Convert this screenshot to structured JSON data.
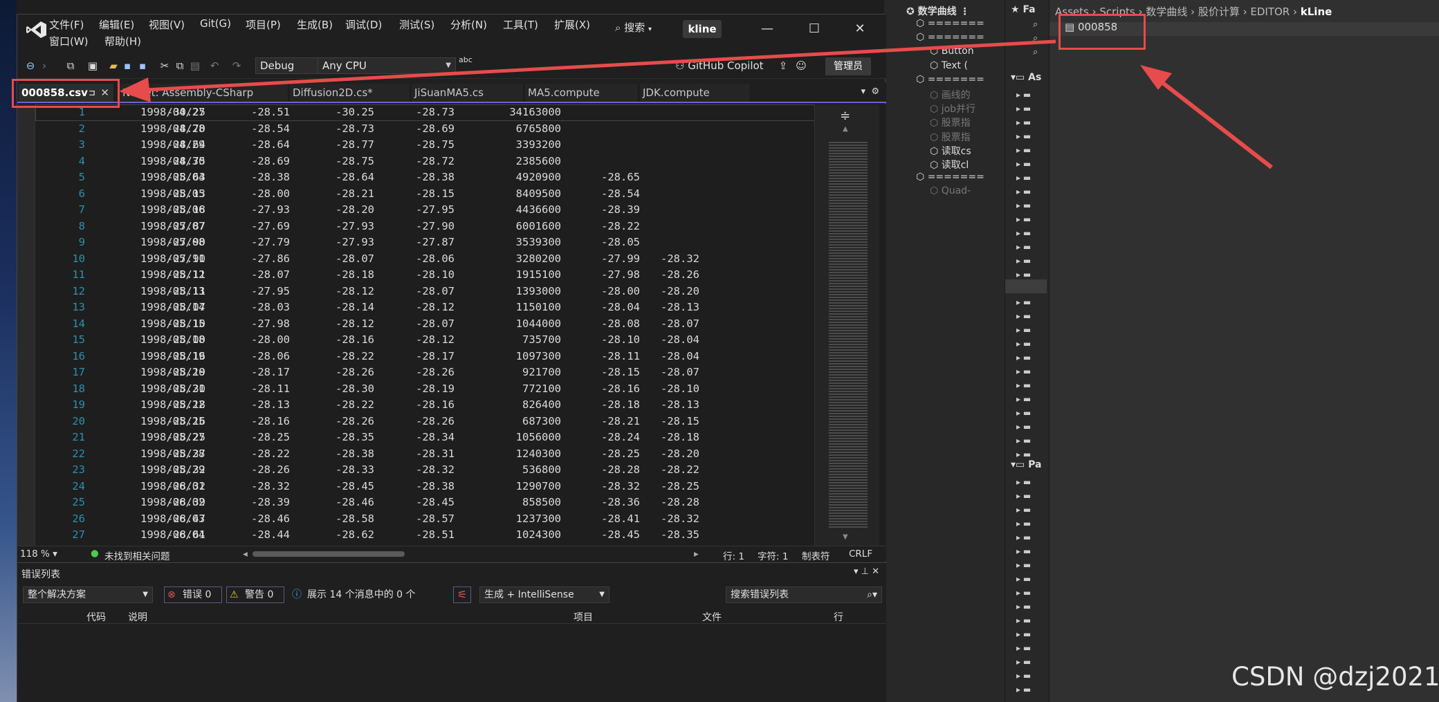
{
  "menu": {
    "row1": [
      "文件(F)",
      "编辑(E)",
      "视图(V)",
      "Git(G)",
      "项目(P)",
      "生成(B)",
      "调试(D)",
      "测试(S)",
      "分析(N)",
      "工具(T)",
      "扩展(X)"
    ],
    "row2": [
      "窗口(W)",
      "帮助(H)"
    ],
    "search_label": "搜索",
    "title": "kline"
  },
  "toolbar": {
    "config": "Debug",
    "platform": "Any CPU",
    "copilot": "GitHub Copilot",
    "admin": "管理员",
    "abc": "abc"
  },
  "tabs": [
    {
      "label": "000858.csv"
    },
    {
      "label": "NuGet: Assembly-CSharp"
    },
    {
      "label": "Diffusion2D.cs*"
    },
    {
      "label": "JiSuanMA5.cs"
    },
    {
      "label": "MA5.compute"
    },
    {
      "label": "JDK.compute"
    }
  ],
  "editor": {
    "rows": [
      [
        "1",
        "1998/04/27",
        "-30.25",
        "-28.51",
        "-30.25",
        "-28.73",
        "34163000",
        "",
        ""
      ],
      [
        "2",
        "1998/04/28",
        "-28.70",
        "-28.54",
        "-28.73",
        "-28.69",
        "6765800",
        "",
        ""
      ],
      [
        "3",
        "1998/04/29",
        "-28.64",
        "-28.64",
        "-28.77",
        "-28.75",
        "3393200",
        "",
        ""
      ],
      [
        "4",
        "1998/04/30",
        "-28.75",
        "-28.69",
        "-28.75",
        "-28.72",
        "2385600",
        "",
        ""
      ],
      [
        "5",
        "1998/05/04",
        "-28.63",
        "-28.38",
        "-28.64",
        "-28.38",
        "4920900",
        "-28.65",
        ""
      ],
      [
        "6",
        "1998/05/05",
        "-28.13",
        "-28.00",
        "-28.21",
        "-28.15",
        "8409500",
        "-28.54",
        ""
      ],
      [
        "7",
        "1998/05/06",
        "-28.18",
        "-27.93",
        "-28.20",
        "-27.95",
        "4436600",
        "-28.39",
        ""
      ],
      [
        "8",
        "1998/05/07",
        "-27.87",
        "-27.69",
        "-27.93",
        "-27.90",
        "6001600",
        "-28.22",
        ""
      ],
      [
        "9",
        "1998/05/08",
        "-27.90",
        "-27.79",
        "-27.93",
        "-27.87",
        "3539300",
        "-28.05",
        ""
      ],
      [
        "10",
        "1998/05/11",
        "-27.90",
        "-27.86",
        "-28.07",
        "-28.06",
        "3280200",
        "-27.99",
        "-28.32"
      ],
      [
        "11",
        "1998/05/12",
        "-28.11",
        "-28.07",
        "-28.18",
        "-28.10",
        "1915100",
        "-27.98",
        "-28.26"
      ],
      [
        "12",
        "1998/05/13",
        "-28.11",
        "-27.95",
        "-28.12",
        "-28.07",
        "1393000",
        "-28.00",
        "-28.20"
      ],
      [
        "13",
        "1998/05/14",
        "-28.07",
        "-28.03",
        "-28.14",
        "-28.12",
        "1150100",
        "-28.04",
        "-28.13"
      ],
      [
        "14",
        "1998/05/15",
        "-28.10",
        "-27.98",
        "-28.12",
        "-28.07",
        "1044000",
        "-28.08",
        "-28.07"
      ],
      [
        "15",
        "1998/05/18",
        "-28.00",
        "-28.00",
        "-28.16",
        "-28.12",
        "735700",
        "-28.10",
        "-28.04"
      ],
      [
        "16",
        "1998/05/19",
        "-28.16",
        "-28.06",
        "-28.22",
        "-28.17",
        "1097300",
        "-28.11",
        "-28.04"
      ],
      [
        "17",
        "1998/05/20",
        "-28.19",
        "-28.17",
        "-28.26",
        "-28.26",
        "921700",
        "-28.15",
        "-28.07"
      ],
      [
        "18",
        "1998/05/21",
        "-28.30",
        "-28.11",
        "-28.30",
        "-28.19",
        "772100",
        "-28.16",
        "-28.10"
      ],
      [
        "19",
        "1998/05/22",
        "-28.18",
        "-28.13",
        "-28.22",
        "-28.16",
        "826400",
        "-28.18",
        "-28.13"
      ],
      [
        "20",
        "1998/05/25",
        "-28.16",
        "-28.16",
        "-28.26",
        "-28.26",
        "687300",
        "-28.21",
        "-28.15"
      ],
      [
        "21",
        "1998/05/27",
        "-28.25",
        "-28.25",
        "-28.35",
        "-28.34",
        "1056000",
        "-28.24",
        "-28.18"
      ],
      [
        "22",
        "1998/05/28",
        "-28.37",
        "-28.22",
        "-28.38",
        "-28.31",
        "1240300",
        "-28.25",
        "-28.20"
      ],
      [
        "23",
        "1998/05/29",
        "-28.32",
        "-28.26",
        "-28.33",
        "-28.32",
        "536800",
        "-28.28",
        "-28.22"
      ],
      [
        "24",
        "1998/06/01",
        "-28.32",
        "-28.32",
        "-28.45",
        "-28.38",
        "1290700",
        "-28.32",
        "-28.25"
      ],
      [
        "25",
        "1998/06/02",
        "-28.39",
        "-28.39",
        "-28.46",
        "-28.45",
        "858500",
        "-28.36",
        "-28.28"
      ],
      [
        "26",
        "1998/06/03",
        "-28.47",
        "-28.46",
        "-28.58",
        "-28.57",
        "1237300",
        "-28.41",
        "-28.32"
      ],
      [
        "27",
        "1998/06/04",
        "-28.61",
        "-28.44",
        "-28.62",
        "-28.51",
        "1024300",
        "-28.45",
        "-28.35"
      ]
    ]
  },
  "status": {
    "zoom": "118 %",
    "issues": "未找到相关问题",
    "line": "行: 1",
    "char": "字符: 1",
    "tab_mode": "制表符",
    "eol": "CRLF"
  },
  "errors": {
    "title": "错误列表",
    "scope": "整个解决方案",
    "errors_label": "错误 0",
    "warnings_label": "警告 0",
    "messages_label": "展示 14 个消息中的 0 个",
    "build_filter": "生成 + IntelliSense",
    "search_placeholder": "搜索错误列表",
    "columns": [
      "代码",
      "说明",
      "项目",
      "文件",
      "行"
    ]
  },
  "unity": {
    "scene_title": "数学曲线",
    "hierarchy": [
      {
        "label": "=======",
        "depth": 0,
        "dim": false
      },
      {
        "label": "=======",
        "depth": 0,
        "dim": false
      },
      {
        "label": "Button",
        "depth": 1,
        "dim": false
      },
      {
        "label": "Text (",
        "depth": 1,
        "dim": false
      },
      {
        "label": "=======",
        "depth": 0,
        "dim": false
      },
      {
        "label": "画线的",
        "depth": 1,
        "dim": true
      },
      {
        "label": "job并行",
        "depth": 1,
        "dim": true
      },
      {
        "label": "股票指",
        "depth": 1,
        "dim": true
      },
      {
        "label": "股票指",
        "depth": 1,
        "dim": true
      },
      {
        "label": "读取cs",
        "depth": 1,
        "dim": false
      },
      {
        "label": "读取cl",
        "depth": 1,
        "dim": false
      },
      {
        "label": "=======",
        "depth": 0,
        "dim": false
      },
      {
        "label": "Quad-",
        "depth": 1,
        "dim": true
      }
    ],
    "proj_fav": "Fa",
    "proj_assets": "As",
    "proj_packages": "Pa",
    "breadcrumb": [
      "Assets",
      "Scripts",
      "数学曲线",
      "股价计算",
      "EDITOR",
      "kLine"
    ],
    "asset_file": "000858"
  },
  "watermark": "CSDN @dzj2021",
  "colors": {
    "highlight": "#e84b4b",
    "accent": "#6b62d6",
    "line_number": "#2b91af"
  }
}
